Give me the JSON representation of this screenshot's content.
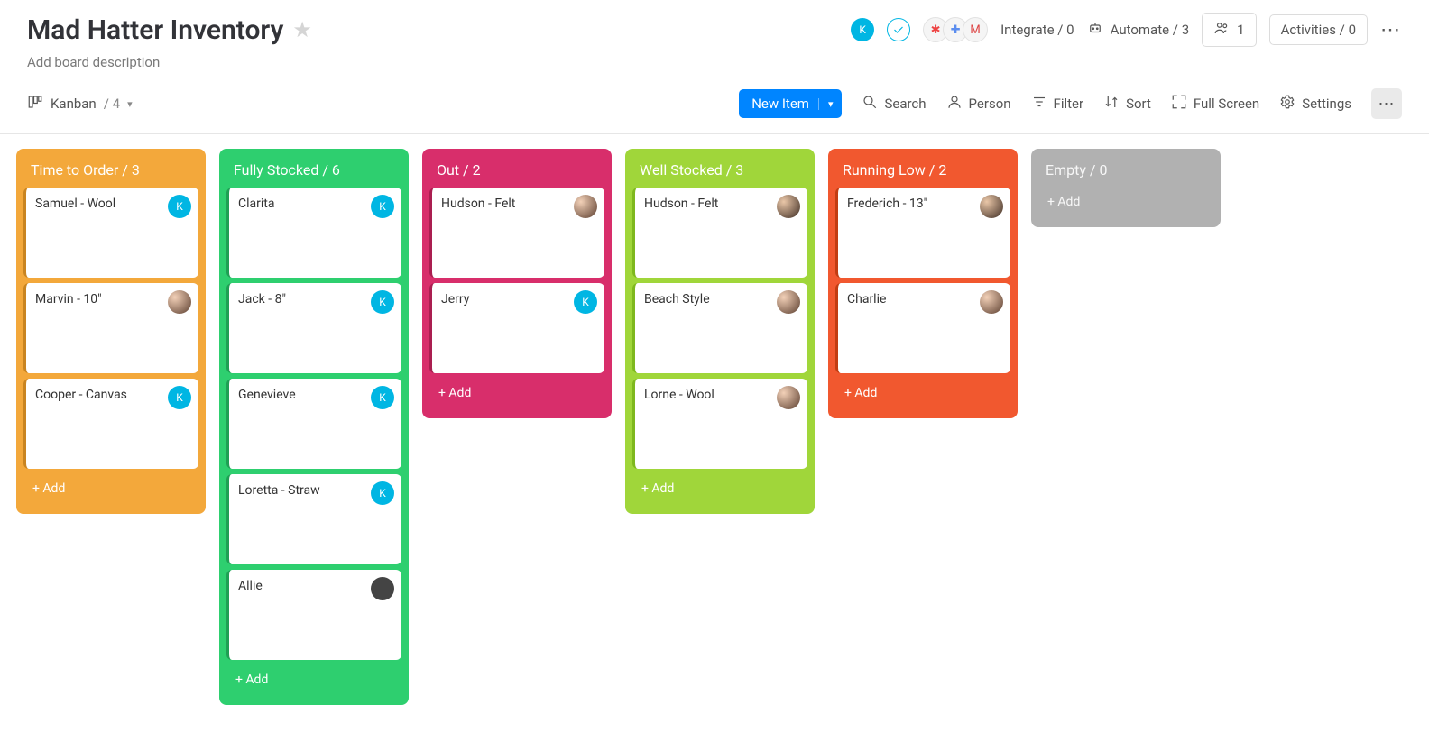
{
  "header": {
    "title": "Mad Hatter Inventory",
    "description_placeholder": "Add board description",
    "integrate_label": "Integrate / 0",
    "automate_label": "Automate / 3",
    "members_count": "1",
    "activities_label": "Activities / 0"
  },
  "toolbar": {
    "view_label": "Kanban",
    "view_count": "/ 4",
    "new_item_label": "New Item",
    "search_label": "Search",
    "person_label": "Person",
    "filter_label": "Filter",
    "sort_label": "Sort",
    "fullscreen_label": "Full Screen",
    "settings_label": "Settings"
  },
  "columns": [
    {
      "title": "Time to Order / 3",
      "color": "col-orange",
      "add_label": "+ Add",
      "cards": [
        {
          "title": "Samuel - Wool",
          "avatar": "av-blue",
          "avatar_letter": "K"
        },
        {
          "title": "Marvin - 10\"",
          "avatar": "av-photo1",
          "avatar_letter": ""
        },
        {
          "title": "Cooper - Canvas",
          "avatar": "av-blue",
          "avatar_letter": "K"
        }
      ]
    },
    {
      "title": "Fully Stocked / 6",
      "color": "col-green",
      "add_label": "+ Add",
      "cards": [
        {
          "title": "Clarita",
          "avatar": "av-blue",
          "avatar_letter": "K"
        },
        {
          "title": "Jack - 8\"",
          "avatar": "av-blue",
          "avatar_letter": "K"
        },
        {
          "title": "Genevieve",
          "avatar": "av-blue",
          "avatar_letter": "K"
        },
        {
          "title": "Loretta - Straw",
          "avatar": "av-blue",
          "avatar_letter": "K"
        },
        {
          "title": "Allie",
          "avatar": "av-dark",
          "avatar_letter": ""
        }
      ]
    },
    {
      "title": "Out / 2",
      "color": "col-pink",
      "add_label": "+ Add",
      "cards": [
        {
          "title": "Hudson - Felt",
          "avatar": "av-photo1",
          "avatar_letter": ""
        },
        {
          "title": "Jerry",
          "avatar": "av-blue",
          "avatar_letter": "K"
        }
      ]
    },
    {
      "title": "Well Stocked / 3",
      "color": "col-lime",
      "add_label": "+ Add",
      "cards": [
        {
          "title": "Hudson - Felt",
          "avatar": "av-photo2",
          "avatar_letter": ""
        },
        {
          "title": "Beach Style",
          "avatar": "av-photo1",
          "avatar_letter": ""
        },
        {
          "title": "Lorne - Wool",
          "avatar": "av-photo1",
          "avatar_letter": ""
        }
      ]
    },
    {
      "title": "Running Low / 2",
      "color": "col-red",
      "add_label": "+ Add",
      "cards": [
        {
          "title": "Frederich - 13\"",
          "avatar": "av-photo2",
          "avatar_letter": ""
        },
        {
          "title": "Charlie",
          "avatar": "av-photo1",
          "avatar_letter": ""
        }
      ]
    },
    {
      "title": "Empty / 0",
      "color": "col-grey",
      "add_label": "+ Add",
      "cards": []
    }
  ]
}
